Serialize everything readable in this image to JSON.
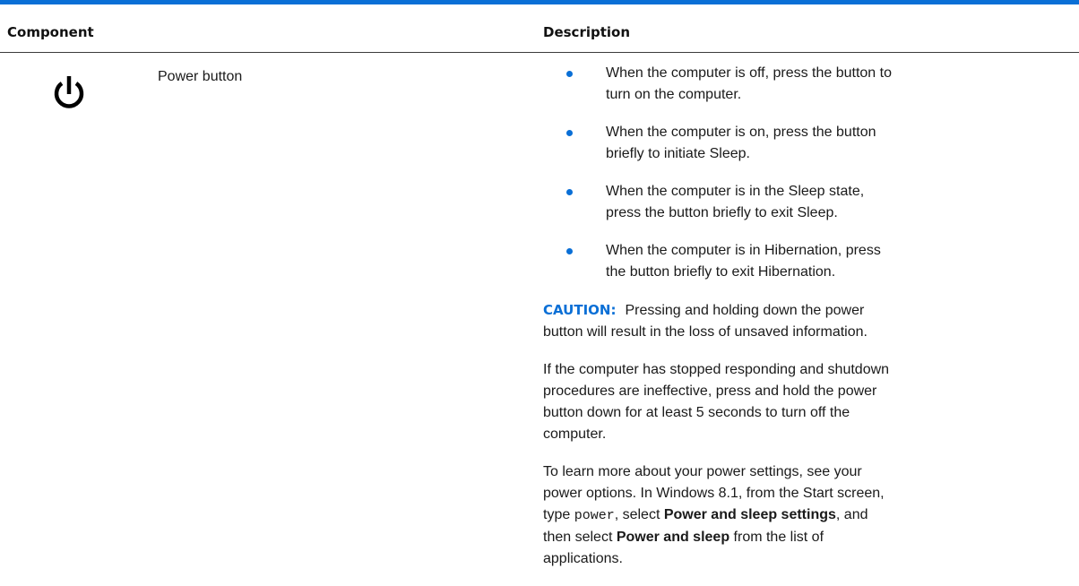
{
  "table": {
    "headers": {
      "component": "Component",
      "description": "Description"
    },
    "row": {
      "icon": "power-icon",
      "component_name": "Power button",
      "bullets": [
        "When the computer is off, press the button to turn on the computer.",
        "When the computer is on, press the button briefly to initiate Sleep.",
        "When the computer is in the Sleep state, press the button briefly to exit Sleep.",
        "When the computer is in Hibernation, press the button briefly to exit Hibernation."
      ],
      "caution": {
        "label": "CAUTION:",
        "text": "Pressing and holding down the power button will result in the loss of unsaved information."
      },
      "shutdown_note": "If the computer has stopped responding and shutdown procedures are ineffective, press and hold the power button down for at least 5 seconds to turn off the computer.",
      "settings_note": {
        "part1": "To learn more about your power settings, see your power options. In Windows 8.1, from the Start screen, type ",
        "code": "power",
        "part2": ", select ",
        "bold1": "Power and sleep settings",
        "part3": ", and then select ",
        "bold2": "Power and sleep",
        "part4": " from the list of applications."
      }
    }
  },
  "colors": {
    "accent": "#0a6fd6",
    "text": "#1a1a1a",
    "rule": "#3c3c3c"
  }
}
